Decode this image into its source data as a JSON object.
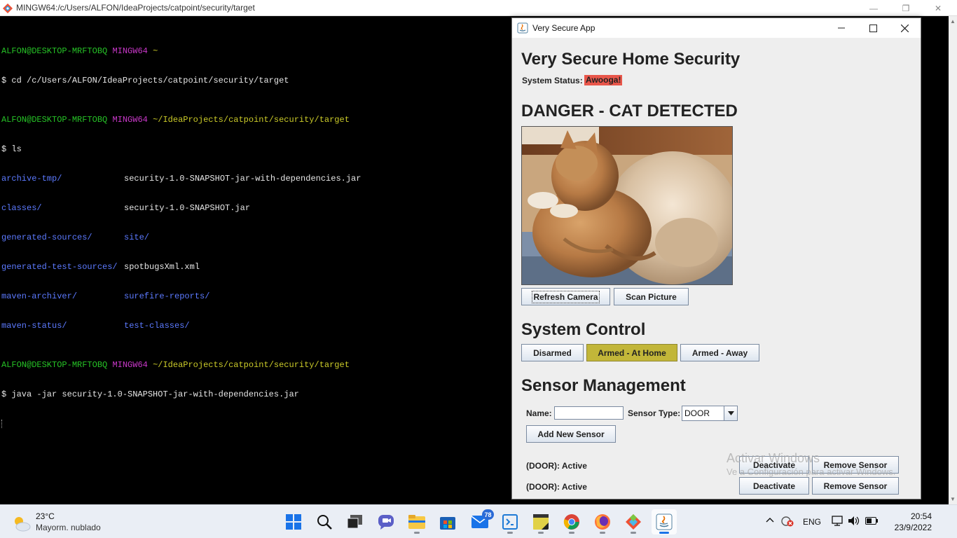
{
  "terminal": {
    "title": "MINGW64:/c/Users/ALFON/IdeaProjects/catpoint/security/target",
    "user_host": "ALFON@DESKTOP-MRFTOBQ",
    "shell": "MINGW64",
    "prompt1_path": "~",
    "cmd1": "$ cd /c/Users/ALFON/IdeaProjects/catpoint/security/target",
    "prompt2_path": "~/IdeaProjects/catpoint/security/target",
    "cmd2": "$ ls",
    "ls_col1": [
      "archive-tmp/",
      "classes/",
      "generated-sources/",
      "generated-test-sources/",
      "maven-archiver/",
      "maven-status/"
    ],
    "ls_col2": [
      "security-1.0-SNAPSHOT-jar-with-dependencies.jar",
      "security-1.0-SNAPSHOT.jar",
      "site/",
      "spotbugsXml.xml",
      "surefire-reports/",
      "test-classes/"
    ],
    "prompt3_path": "~/IdeaProjects/catpoint/security/target",
    "cmd3": "$ java -jar security-1.0-SNAPSHOT-jar-with-dependencies.jar"
  },
  "app": {
    "window_title": "Very Secure App",
    "heading": "Very Secure Home Security",
    "status_label": "System Status:",
    "status_value": "Awooga!",
    "alert_heading": "DANGER - CAT DETECTED",
    "buttons": {
      "refresh_camera": "Refresh Camera",
      "scan_picture": "Scan Picture"
    },
    "control_heading": "System Control",
    "modes": [
      {
        "label": "Disarmed",
        "selected": false
      },
      {
        "label": "Armed - At Home",
        "selected": true
      },
      {
        "label": "Armed - Away",
        "selected": false
      }
    ],
    "selected_color": "#c2b639",
    "sensor_heading": "Sensor Management",
    "name_label": "Name:",
    "name_value": "",
    "sensor_type_label": "Sensor Type:",
    "sensor_type_value": "DOOR",
    "add_sensor": "Add New Sensor",
    "sensors": [
      {
        "label": "(DOOR): Active",
        "toggle": "Deactivate",
        "remove": "Remove Sensor"
      },
      {
        "label": "(DOOR): Active",
        "toggle": "Deactivate",
        "remove": "Remove Sensor"
      }
    ],
    "watermark_line1": "Activar Windows",
    "watermark_line2": "Ve a Configuración para activar Windows."
  },
  "taskbar": {
    "temperature": "23°C",
    "weather_desc": "Mayorm. nublado",
    "mail_badge": "78",
    "language": "ENG",
    "time": "20:54",
    "date": "23/9/2022",
    "apps": [
      "windows-start-icon",
      "search-icon",
      "task-view-icon",
      "chat-icon",
      "file-explorer-icon",
      "store-icon",
      "mail-icon",
      "vscode-icon",
      "sticky-notes-icon",
      "chrome-icon",
      "firefox-icon",
      "git-icon",
      "java-icon"
    ]
  }
}
